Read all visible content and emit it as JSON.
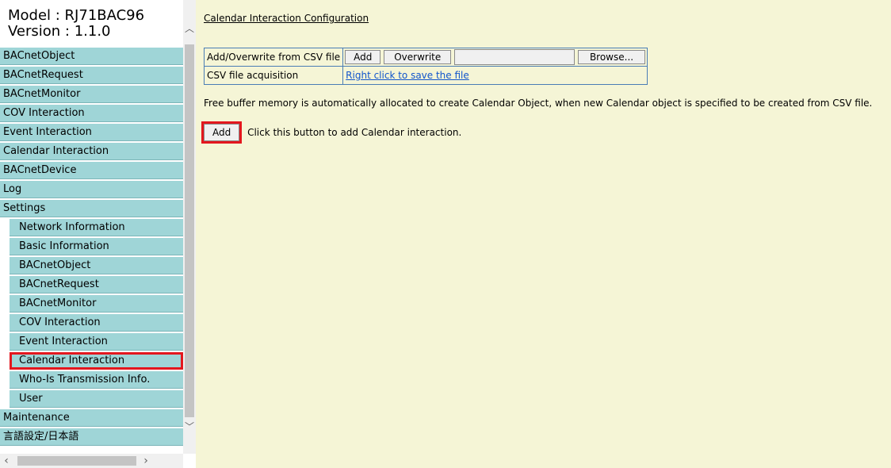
{
  "sidebar": {
    "model": "Model : RJ71BAC96",
    "version": "Version : 1.1.0",
    "items": [
      {
        "label": "BACnetObject",
        "sub": false
      },
      {
        "label": "BACnetRequest",
        "sub": false
      },
      {
        "label": "BACnetMonitor",
        "sub": false
      },
      {
        "label": "COV Interaction",
        "sub": false
      },
      {
        "label": "Event Interaction",
        "sub": false
      },
      {
        "label": "Calendar Interaction",
        "sub": false
      },
      {
        "label": "BACnetDevice",
        "sub": false
      },
      {
        "label": "Log",
        "sub": false
      },
      {
        "label": "Settings",
        "sub": false
      },
      {
        "label": "Network Information",
        "sub": true
      },
      {
        "label": "Basic Information",
        "sub": true
      },
      {
        "label": "BACnetObject",
        "sub": true
      },
      {
        "label": "BACnetRequest",
        "sub": true
      },
      {
        "label": "BACnetMonitor",
        "sub": true
      },
      {
        "label": "COV Interaction",
        "sub": true
      },
      {
        "label": "Event Interaction",
        "sub": true
      },
      {
        "label": "Calendar Interaction",
        "sub": true,
        "active": true
      },
      {
        "label": "Who-Is Transmission Info.",
        "sub": true
      },
      {
        "label": "User",
        "sub": true
      },
      {
        "label": "Maintenance",
        "sub": false
      },
      {
        "label": "言語設定/日本語",
        "sub": false
      }
    ]
  },
  "main": {
    "title": "Calendar Interaction Configuration",
    "csv": {
      "row1_label": "Add/Overwrite from CSV file",
      "add_label": "Add",
      "overwrite_label": "Overwrite",
      "browse_label": "Browse...",
      "row2_label": "CSV file acquisition",
      "row2_link": "Right click to save the file"
    },
    "note": "Free buffer memory is automatically allocated to create Calendar Object, when new Calendar object is specified to be created from CSV file.",
    "add_button": "Add",
    "add_text": "Click this button to add Calendar interaction."
  },
  "icons": {
    "scroll_up": "chevron-up-icon",
    "scroll_down": "chevron-down-icon",
    "scroll_left": "chevron-left-icon",
    "scroll_right": "chevron-right-icon"
  },
  "colors": {
    "nav_bg": "#9fd5d7",
    "main_bg": "#f5f5d6",
    "highlight": "#e3171e",
    "link": "#1155cc"
  }
}
